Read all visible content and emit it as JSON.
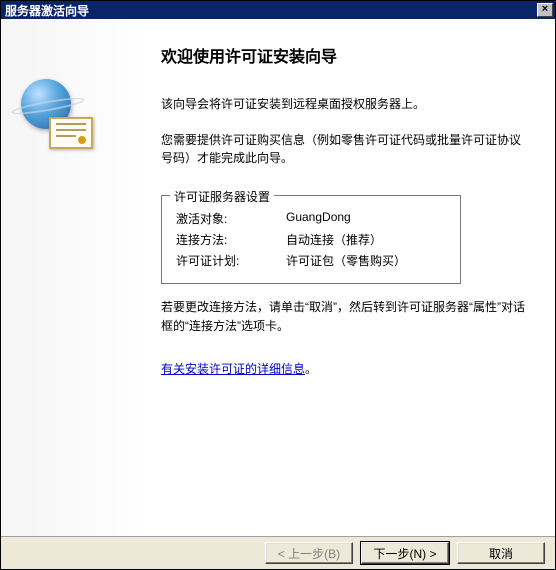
{
  "window": {
    "title": "服务器激活向导",
    "close_symbol": "×"
  },
  "main": {
    "heading": "欢迎使用许可证安装向导",
    "desc1": "该向导会将许可证安装到远程桌面授权服务器上。",
    "desc2": "您需要提供许可证购买信息（例如零售许可证代码或批量许可证协议号码）才能完成此向导。"
  },
  "group": {
    "title": "许可证服务器设置",
    "rows": [
      {
        "label": "激活对象:",
        "value": "GuangDong"
      },
      {
        "label": "连接方法:",
        "value": "自动连接（推荐）"
      },
      {
        "label": "许可证计划:",
        "value": "许可证包（零售购买）"
      }
    ]
  },
  "note": "若要更改连接方法，请单击“取消”，然后转到许可证服务器“属性”对话框的“连接方法”选项卡。",
  "link": "有关安装许可证的详细信息",
  "link_suffix": "。",
  "buttons": {
    "back": "< 上一步(B)",
    "next": "下一步(N) >",
    "cancel": "取消"
  }
}
